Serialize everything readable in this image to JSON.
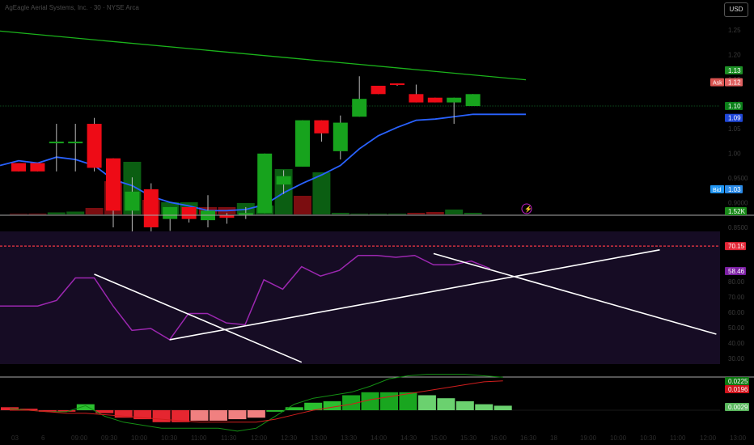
{
  "header": {
    "title": "AgEagle Aerial Systems, Inc. · 30 · NYSE Arca",
    "currency_button": "USD"
  },
  "colors": {
    "up": "#089981",
    "down": "#f23645",
    "ema": "#2962ff",
    "long_ma": "#1bb31b",
    "rsi": "#9c27b0",
    "rsi_band": "#160c24"
  },
  "chart_data": [
    {
      "type": "candlestick",
      "pane": "price",
      "price_axis_ticks": [
        "1.25",
        "1.20",
        "1.15",
        "1.10",
        "1.05",
        "1.00",
        "0.9500",
        "0.9000",
        "0.8500"
      ],
      "candles": [
        {
          "o": 1.052,
          "h": 1.052,
          "l": 1.045,
          "c": 1.045
        },
        {
          "o": 1.052,
          "h": 1.052,
          "l": 1.045,
          "c": 1.045
        },
        {
          "o": 1.07,
          "h": 1.085,
          "l": 1.045,
          "c": 1.07
        },
        {
          "o": 1.07,
          "h": 1.085,
          "l": 1.045,
          "c": 1.07
        },
        {
          "o": 1.085,
          "h": 1.09,
          "l": 1.045,
          "c": 1.048
        },
        {
          "o": 1.056,
          "h": 1.056,
          "l": 0.998,
          "c": 1.012
        },
        {
          "o": 1.012,
          "h": 1.04,
          "l": 0.985,
          "c": 1.028
        },
        {
          "o": 1.03,
          "h": 1.035,
          "l": 0.99,
          "c": 0.998
        },
        {
          "o": 1.005,
          "h": 1.015,
          "l": 0.995,
          "c": 1.015
        },
        {
          "o": 1.015,
          "h": 1.015,
          "l": 1.002,
          "c": 1.005
        },
        {
          "o": 1.004,
          "h": 1.025,
          "l": 0.998,
          "c": 1.012
        },
        {
          "o": 1.008,
          "h": 1.01,
          "l": 1.001,
          "c": 1.006
        },
        {
          "o": 1.01,
          "h": 1.015,
          "l": 1.005,
          "c": 1.01
        },
        {
          "o": 1.01,
          "h": 1.06,
          "l": 1.01,
          "c": 1.06
        },
        {
          "o": 1.034,
          "h": 1.046,
          "l": 1.026,
          "c": 1.041
        },
        {
          "o": 1.049,
          "h": 1.088,
          "l": 1.049,
          "c": 1.088
        },
        {
          "o": 1.088,
          "h": 1.088,
          "l": 1.07,
          "c": 1.077
        },
        {
          "o": 1.062,
          "h": 1.092,
          "l": 1.055,
          "c": 1.086
        },
        {
          "o": 1.091,
          "h": 1.125,
          "l": 1.091,
          "c": 1.106
        },
        {
          "o": 1.117,
          "h": 1.117,
          "l": 1.11,
          "c": 1.11
        },
        {
          "o": 1.119,
          "h": 1.119,
          "l": 1.117,
          "c": 1.118
        },
        {
          "o": 1.11,
          "h": 1.118,
          "l": 1.103,
          "c": 1.103
        },
        {
          "o": 1.107,
          "h": 1.107,
          "l": 1.103,
          "c": 1.103
        },
        {
          "o": 1.103,
          "h": 1.107,
          "l": 1.085,
          "c": 1.107
        },
        {
          "o": 1.1,
          "h": 1.11,
          "l": 1.1,
          "c": 1.11
        }
      ],
      "volume": [
        1.5,
        2,
        5,
        7,
        16,
        82,
        130,
        36,
        30,
        30,
        18,
        18,
        28,
        22,
        112,
        46,
        104,
        4,
        2,
        2,
        2,
        4,
        6,
        12,
        4
      ],
      "volume_colors": [
        "down",
        "down",
        "up",
        "up",
        "down",
        "down",
        "up",
        "down",
        "up",
        "up",
        "down",
        "down",
        "up",
        "up",
        "up",
        "down",
        "up",
        "up",
        "up",
        "up",
        "up",
        "down",
        "down",
        "up",
        "up"
      ],
      "ema": [
        1.054,
        1.052,
        1.057,
        1.055,
        1.05,
        1.038,
        1.033,
        1.024,
        1.019,
        1.016,
        1.012,
        1.012,
        1.013,
        1.017,
        1.027,
        1.035,
        1.042,
        1.05,
        1.064,
        1.075,
        1.082,
        1.088,
        1.089,
        1.091,
        1.093
      ],
      "long_ma_start": 1.163,
      "long_ma_end": 1.122,
      "labels": {
        "ma": "1.13",
        "ask_tag": "Ask",
        "ask": "1.12",
        "last": "1.10",
        "ema": "1.09",
        "bid_tag": "Bid",
        "bid": "1.03",
        "volume": "1.52K"
      },
      "label_values": {
        "ma": 1.13,
        "ask": 1.12,
        "last": 1.1,
        "ema": 1.09,
        "bid": 1.03
      }
    },
    {
      "type": "line",
      "pane": "rsi",
      "name": "",
      "values": [
        56,
        56,
        56,
        59,
        71,
        71,
        56,
        43,
        44,
        38,
        52,
        52,
        47,
        46,
        70,
        65,
        77,
        72,
        75,
        83,
        83,
        82,
        83,
        78,
        78,
        80,
        76
      ],
      "ylim": [
        25,
        95
      ],
      "upper_value": "70.15",
      "current_value": "58.46",
      "upper_level": 88,
      "axis_ticks": [
        "80.00",
        "70.00",
        "60.00",
        "50.00",
        "40.00",
        "30.00"
      ],
      "trendlines": [
        {
          "from": [
            5,
            73
          ],
          "to": [
            16,
            26
          ]
        },
        {
          "from": [
            9,
            38
          ],
          "to": [
            35,
            86
          ]
        },
        {
          "from": [
            23,
            84
          ],
          "to": [
            38,
            41
          ]
        }
      ]
    },
    {
      "type": "bar",
      "pane": "macd",
      "histogram": [
        0.002,
        0.001,
        -0.001,
        -0.001,
        0.004,
        -0.002,
        -0.005,
        -0.006,
        -0.008,
        -0.008,
        -0.007,
        -0.007,
        -0.006,
        -0.005,
        -0.001,
        0.002,
        0.005,
        0.006,
        0.01,
        0.012,
        0.012,
        0.012,
        0.01,
        0.008,
        0.006,
        0.004,
        0.003
      ],
      "histogram_colors": [
        "down",
        "down",
        "down",
        "down",
        "up",
        "down",
        "down",
        "down",
        "down",
        "down",
        "down",
        "down",
        "down",
        "down",
        "up",
        "up",
        "up",
        "up",
        "up",
        "up",
        "up",
        "up",
        "up",
        "up",
        "up",
        "up",
        "up"
      ],
      "macd_line": [
        0.001,
        0.0,
        -0.001,
        -0.001,
        0.003,
        -0.004,
        -0.008,
        -0.01,
        -0.012,
        -0.012,
        -0.012,
        -0.012,
        -0.014,
        -0.012,
        -0.004,
        0.004,
        0.008,
        0.01,
        0.012,
        0.016,
        0.021,
        0.023,
        0.024,
        0.024,
        0.024,
        0.023,
        0.022
      ],
      "signal_line": [
        0.0,
        0.0,
        -0.001,
        -0.002,
        -0.002,
        -0.003,
        -0.004,
        -0.005,
        -0.006,
        -0.007,
        -0.008,
        -0.008,
        -0.008,
        -0.008,
        -0.006,
        -0.003,
        0.0,
        0.002,
        0.004,
        0.007,
        0.009,
        0.011,
        0.013,
        0.015,
        0.017,
        0.019,
        0.0196
      ],
      "ylim": [
        -0.012,
        0.026
      ],
      "macd_value": "0.0225",
      "signal_value": "0.0196",
      "hist_value": "0.0029",
      "time_ticks": [
        "03",
        "6",
        "09:00",
        "09:30",
        "10:00",
        "10:30",
        "11:00",
        "11:30",
        "12:00",
        "12:30",
        "13:00",
        "13:30",
        "14:00",
        "14:30",
        "15:00",
        "15:30",
        "16:00",
        "16:30",
        "18",
        "19:00",
        "10:00",
        "10:30",
        "11:00",
        "12:00",
        "13:00"
      ]
    }
  ]
}
